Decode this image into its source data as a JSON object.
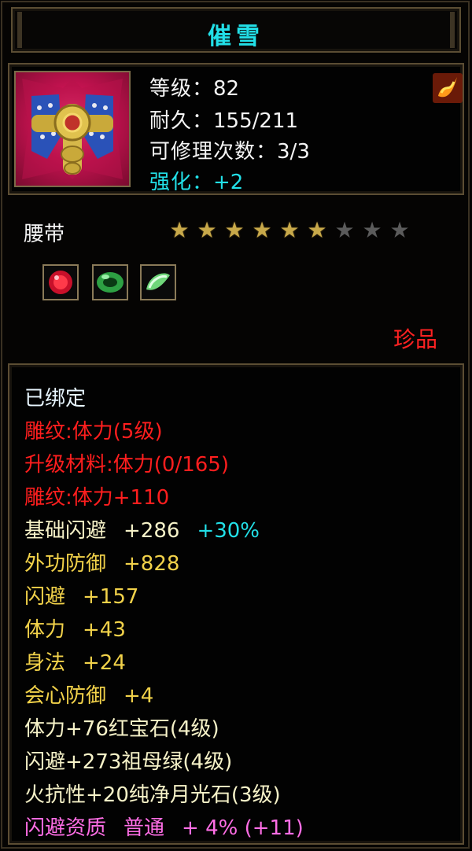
{
  "title": "催雪",
  "item": {
    "icon": "belt-icon",
    "level_label": "等级：",
    "level_value": "82",
    "durability_label": "耐久：",
    "durability_value": "155/211",
    "repair_label": "可修理次数：",
    "repair_value": "3/3",
    "enhance_label": "强化：",
    "enhance_value": "+2",
    "badge_icon": "flag-icon"
  },
  "type": "腰带",
  "stars": {
    "filled": 6,
    "total": 9
  },
  "gems": [
    {
      "icon": "ruby-gem-icon",
      "color": "#c8102a"
    },
    {
      "icon": "emerald-gem-icon",
      "color": "#2da043"
    },
    {
      "icon": "moonstone-gem-icon",
      "color": "#6fd67a"
    }
  ],
  "rarity": "珍品",
  "attributes": {
    "bound": "已绑定",
    "engrave": "雕纹:体力(5级)",
    "upgrade_material": "升级材料:体力(0/165)",
    "engrave_bonus": "雕纹:体力+110",
    "dodge_base_label": "基础闪避",
    "dodge_base_value": "+286",
    "dodge_base_bonus": "+30%",
    "ext_defense_label": "外功防御",
    "ext_defense_value": "+828",
    "dodge_label": "闪避",
    "dodge_value": "+157",
    "stamina_label": "体力",
    "stamina_value": "+43",
    "agility_label": "身法",
    "agility_value": "+24",
    "crit_def_label": "会心防御",
    "crit_def_value": "+4",
    "gem1": "体力+76红宝石(4级)",
    "gem2": "闪避+273祖母绿(4级)",
    "gem3": "火抗性+20纯净月光石(3级)",
    "quality_label": "闪避资质",
    "quality_grade": "普通",
    "quality_value": "+ 4% (+11)"
  },
  "colors": {
    "title": "#22e0e8",
    "engrave": "#ff1e1e",
    "stat": "#f2d24a",
    "gem": "#f6f2c8",
    "quality": "#ff6ee6"
  }
}
